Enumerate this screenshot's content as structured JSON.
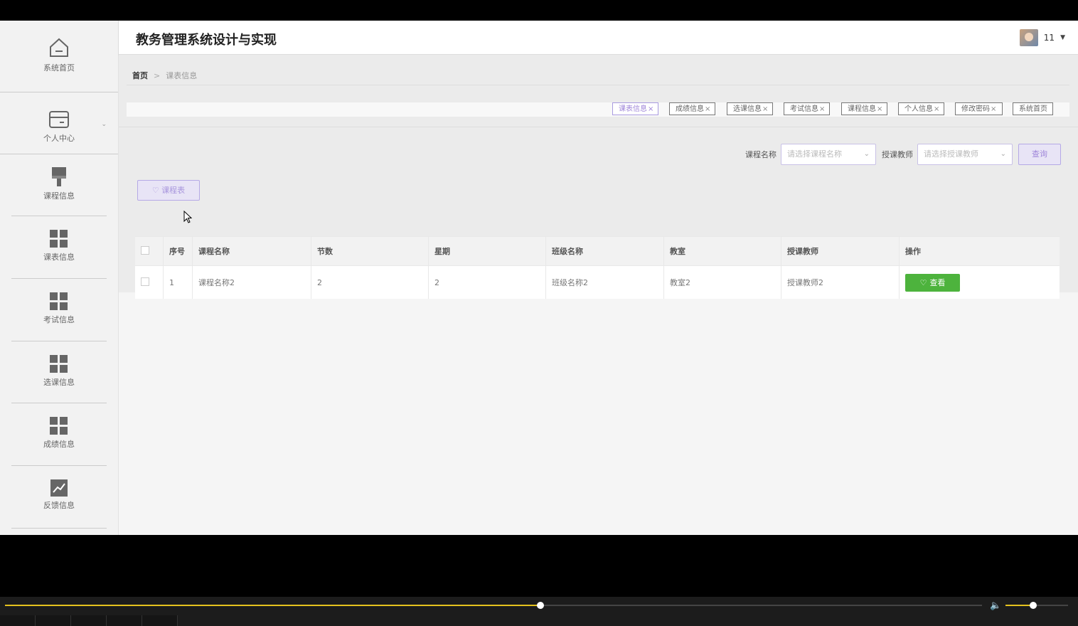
{
  "app": {
    "title": "教务管理系统设计与实现",
    "user": {
      "name": "11"
    }
  },
  "sidebar": {
    "items": [
      {
        "label": "系统首页",
        "icon": "home-icon"
      },
      {
        "label": "个人中心",
        "icon": "card-icon"
      },
      {
        "label": "课程信息",
        "icon": "brush-icon"
      },
      {
        "label": "课表信息",
        "icon": "grid-icon"
      },
      {
        "label": "考试信息",
        "icon": "grid-icon"
      },
      {
        "label": "选课信息",
        "icon": "grid-icon"
      },
      {
        "label": "成绩信息",
        "icon": "grid-icon"
      },
      {
        "label": "反馈信息",
        "icon": "chart-icon"
      }
    ]
  },
  "breadcrumb": {
    "home": "首页",
    "sep": ">",
    "current": "课表信息"
  },
  "tabs": [
    {
      "label": "课表信息",
      "close": "×"
    },
    {
      "label": "成绩信息",
      "close": "×"
    },
    {
      "label": "选课信息",
      "close": "×"
    },
    {
      "label": "考试信息",
      "close": "×"
    },
    {
      "label": "课程信息",
      "close": "×"
    },
    {
      "label": "个人信息",
      "close": "×"
    },
    {
      "label": "修改密码",
      "close": "×"
    },
    {
      "label": "系统首页",
      "close": ""
    }
  ],
  "search": {
    "course_label": "课程名称",
    "course_placeholder": "请选择课程名称",
    "teacher_label": "授课教师",
    "teacher_placeholder": "请选择授课教师",
    "query_label": "查询"
  },
  "schedule_button": {
    "label": "课程表"
  },
  "table": {
    "headers": [
      "序号",
      "课程名称",
      "节数",
      "星期",
      "班级名称",
      "教室",
      "授课教师",
      "操作"
    ],
    "rows": [
      {
        "no": "1",
        "course": "课程名称2",
        "sections": "2",
        "weekday": "2",
        "class": "班级名称2",
        "room": "教室2",
        "teacher": "授课教师2",
        "action": "查看"
      }
    ]
  },
  "player": {
    "progress": 0.548,
    "volume": 0.44
  },
  "colors": {
    "accent": "#9f86d9",
    "success": "#4db33d",
    "progress": "#e4c21e"
  }
}
